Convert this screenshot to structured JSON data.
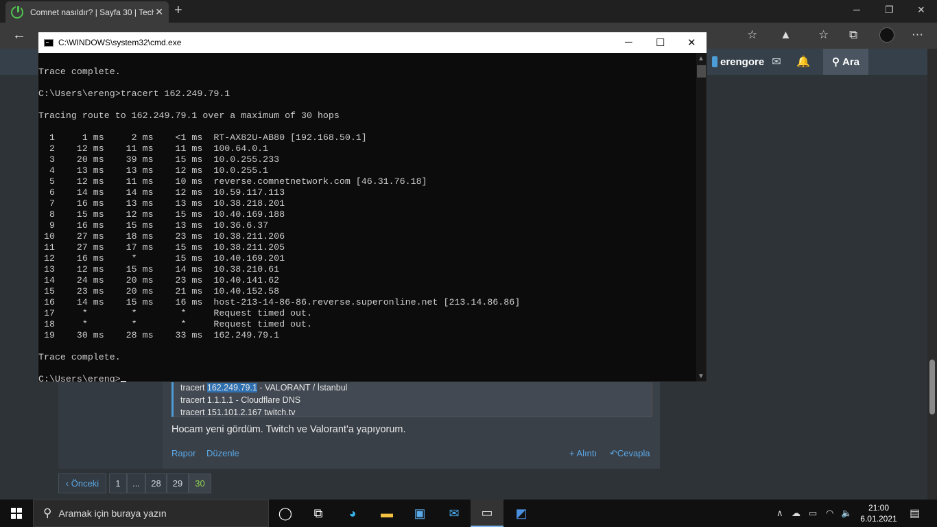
{
  "browser": {
    "tab_title": "Comnet nasıldır? | Sayfa 30 | Tech",
    "tab_close": "✕",
    "new_tab": "+"
  },
  "forum": {
    "username": "erengore",
    "search_label": "Ara",
    "quote_lines": [
      {
        "prefix": "tracert ",
        "highlight": "162.249.79.1",
        "suffix": " - VALORANT / İstanbul"
      },
      {
        "text": "tracert 1.1.1.1 - Cloudflare DNS"
      },
      {
        "text": "tracert 151.101.2.167 twitch.tv"
      }
    ],
    "post_text": "Hocam yeni gördüm. Twitch ve Valorant'a yapıyorum.",
    "actions": {
      "report": "Rapor",
      "edit": "Düzenle",
      "quote": "+ Alıntı",
      "reply": "Cevapla"
    },
    "pagination": {
      "prev": "‹ Önceki",
      "pages": [
        "1",
        "...",
        "28",
        "29",
        "30"
      ],
      "current": "30"
    }
  },
  "cmd": {
    "title": "C:\\WINDOWS\\system32\\cmd.exe",
    "lines": [
      "Trace complete.",
      "",
      "C:\\Users\\ereng>tracert 162.249.79.1",
      "",
      "Tracing route to 162.249.79.1 over a maximum of 30 hops",
      "",
      "  1     1 ms     2 ms    <1 ms  RT-AX82U-AB80 [192.168.50.1]",
      "  2    12 ms    11 ms    11 ms  100.64.0.1",
      "  3    20 ms    39 ms    15 ms  10.0.255.233",
      "  4    13 ms    13 ms    12 ms  10.0.255.1",
      "  5    12 ms    11 ms    10 ms  reverse.comnetnetwork.com [46.31.76.18]",
      "  6    14 ms    14 ms    12 ms  10.59.117.113",
      "  7    16 ms    13 ms    13 ms  10.38.218.201",
      "  8    15 ms    12 ms    15 ms  10.40.169.188",
      "  9    16 ms    15 ms    13 ms  10.36.6.37",
      " 10    27 ms    18 ms    23 ms  10.38.211.206",
      " 11    27 ms    17 ms    15 ms  10.38.211.205",
      " 12    16 ms     *       15 ms  10.40.169.201",
      " 13    12 ms    15 ms    14 ms  10.38.210.61",
      " 14    24 ms    20 ms    23 ms  10.40.141.62",
      " 15    23 ms    20 ms    21 ms  10.40.152.58",
      " 16    14 ms    15 ms    16 ms  host-213-14-86-86.reverse.superonline.net [213.14.86.86]",
      " 17     *        *        *     Request timed out.",
      " 18     *        *        *     Request timed out.",
      " 19    30 ms    28 ms    33 ms  162.249.79.1",
      "",
      "Trace complete.",
      ""
    ],
    "prompt": "C:\\Users\\ereng>"
  },
  "taskbar": {
    "search_placeholder": "Aramak için buraya yazın",
    "time": "21:00",
    "date": "6.01.2021"
  },
  "colors": {
    "cmd_bg": "#0c0c0c",
    "cmd_text": "#cccccc",
    "link": "#5aa8e6",
    "current_page": "#8fd14f",
    "quote_highlight": "#2e6fb0"
  }
}
